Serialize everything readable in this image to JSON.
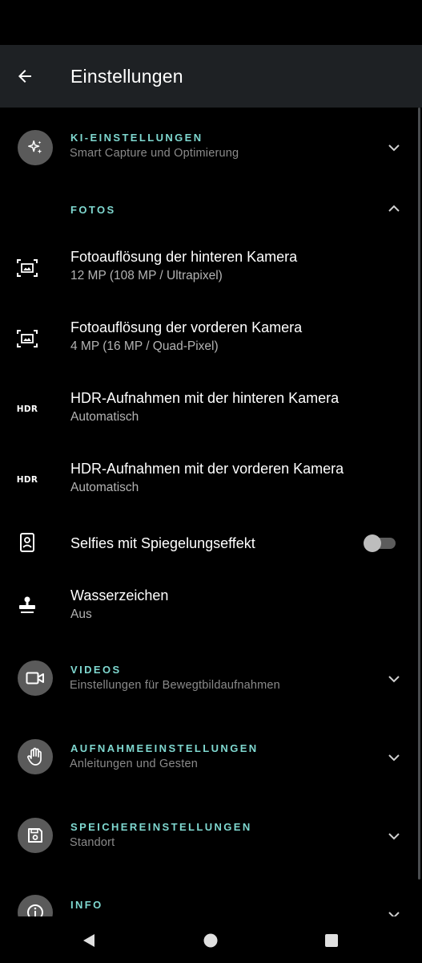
{
  "app_bar": {
    "title": "Einstellungen"
  },
  "sections": {
    "ki": {
      "title": "KI-EINSTELLUNGEN",
      "subtitle": "Smart Capture und Optimierung"
    },
    "fotos": {
      "title": "FOTOS"
    },
    "videos": {
      "title": "VIDEOS",
      "subtitle": "Einstellungen für Bewegtbildaufnahmen"
    },
    "aufnahme": {
      "title": "AUFNAHMEEINSTELLUNGEN",
      "subtitle": "Anleitungen und Gesten"
    },
    "speicher": {
      "title": "SPEICHEREINSTELLUNGEN",
      "subtitle": "Standort"
    },
    "info": {
      "title": "INFO"
    }
  },
  "fotos_items": {
    "rear_resolution": {
      "title": "Fotoauflösung der hinteren Kamera",
      "value": "12 MP (108 MP / Ultrapixel)"
    },
    "front_resolution": {
      "title": "Fotoauflösung der vorderen Kamera",
      "value": "4 MP (16 MP / Quad-Pixel)"
    },
    "hdr_rear": {
      "title": "HDR-Aufnahmen mit der hinteren Kamera",
      "value": "Automatisch",
      "icon_label": "HDR"
    },
    "hdr_front": {
      "title": "HDR-Aufnahmen mit der vorderen Kamera",
      "value": "Automatisch",
      "icon_label": "HDR"
    },
    "mirror_selfies": {
      "title": "Selfies mit Spiegelungseffekt",
      "enabled": false
    },
    "watermark": {
      "title": "Wasserzeichen",
      "value": "Aus"
    }
  },
  "colors": {
    "accent": "#7fd8d0",
    "app_bar_bg": "#1e2124",
    "background": "#000000",
    "icon_circle": "#5a5a5a"
  },
  "icons": {
    "back": "arrow-back-icon",
    "ki": "sparkle-icon",
    "resolution": "photo-resolution-icon",
    "selfie": "portrait-icon",
    "watermark": "stamp-icon",
    "videos": "videocam-icon",
    "aufnahme": "hand-icon",
    "speicher": "save-icon",
    "info": "info-icon"
  }
}
